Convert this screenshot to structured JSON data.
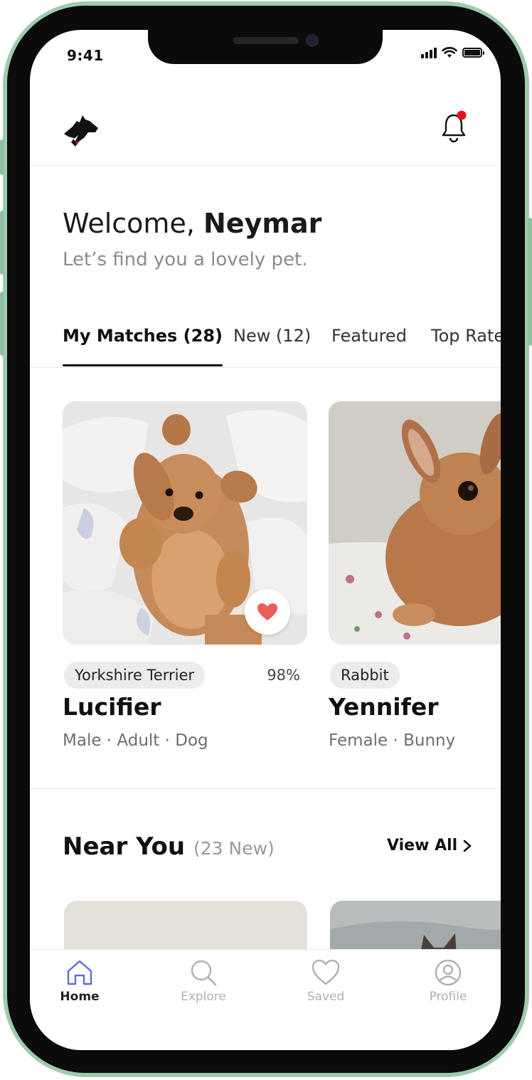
{
  "status_bar": {
    "time": "9:41"
  },
  "header": {
    "logo_icon": "dog-logo-icon",
    "notification_icon": "bell-icon",
    "notification_dot_color": "#e3101e"
  },
  "welcome": {
    "greeting": "Welcome,",
    "user_name": "Neymar",
    "subtitle": "Let’s find you a lovely pet."
  },
  "tabs": [
    {
      "label": "My Matches (28)",
      "active": true
    },
    {
      "label": "New (12)",
      "active": false
    },
    {
      "label": "Featured",
      "active": false
    },
    {
      "label": "Top Rated",
      "active": false
    }
  ],
  "matches": [
    {
      "breed": "Yorkshire Terrier",
      "match": "98%",
      "name": "Lucifier",
      "meta": "Male · Adult · Dog",
      "liked": true
    },
    {
      "breed": "Rabbit",
      "match": "",
      "name": "Yennifer",
      "meta": "Female · Bunny",
      "liked": false
    }
  ],
  "near_you": {
    "title": "Near You",
    "count": "(23 New)",
    "view_all": "View All"
  },
  "bottom_nav": [
    {
      "label": "Home",
      "icon": "home-icon",
      "active": true
    },
    {
      "label": "Explore",
      "icon": "search-icon",
      "active": false
    },
    {
      "label": "Saved",
      "icon": "heart-icon",
      "active": false
    },
    {
      "label": "Profile",
      "icon": "profile-icon",
      "active": false
    }
  ],
  "colors": {
    "like_heart": "#ef5a5a",
    "active_nav_icon": "#5b6fd6",
    "frame": "#9ecbae"
  }
}
